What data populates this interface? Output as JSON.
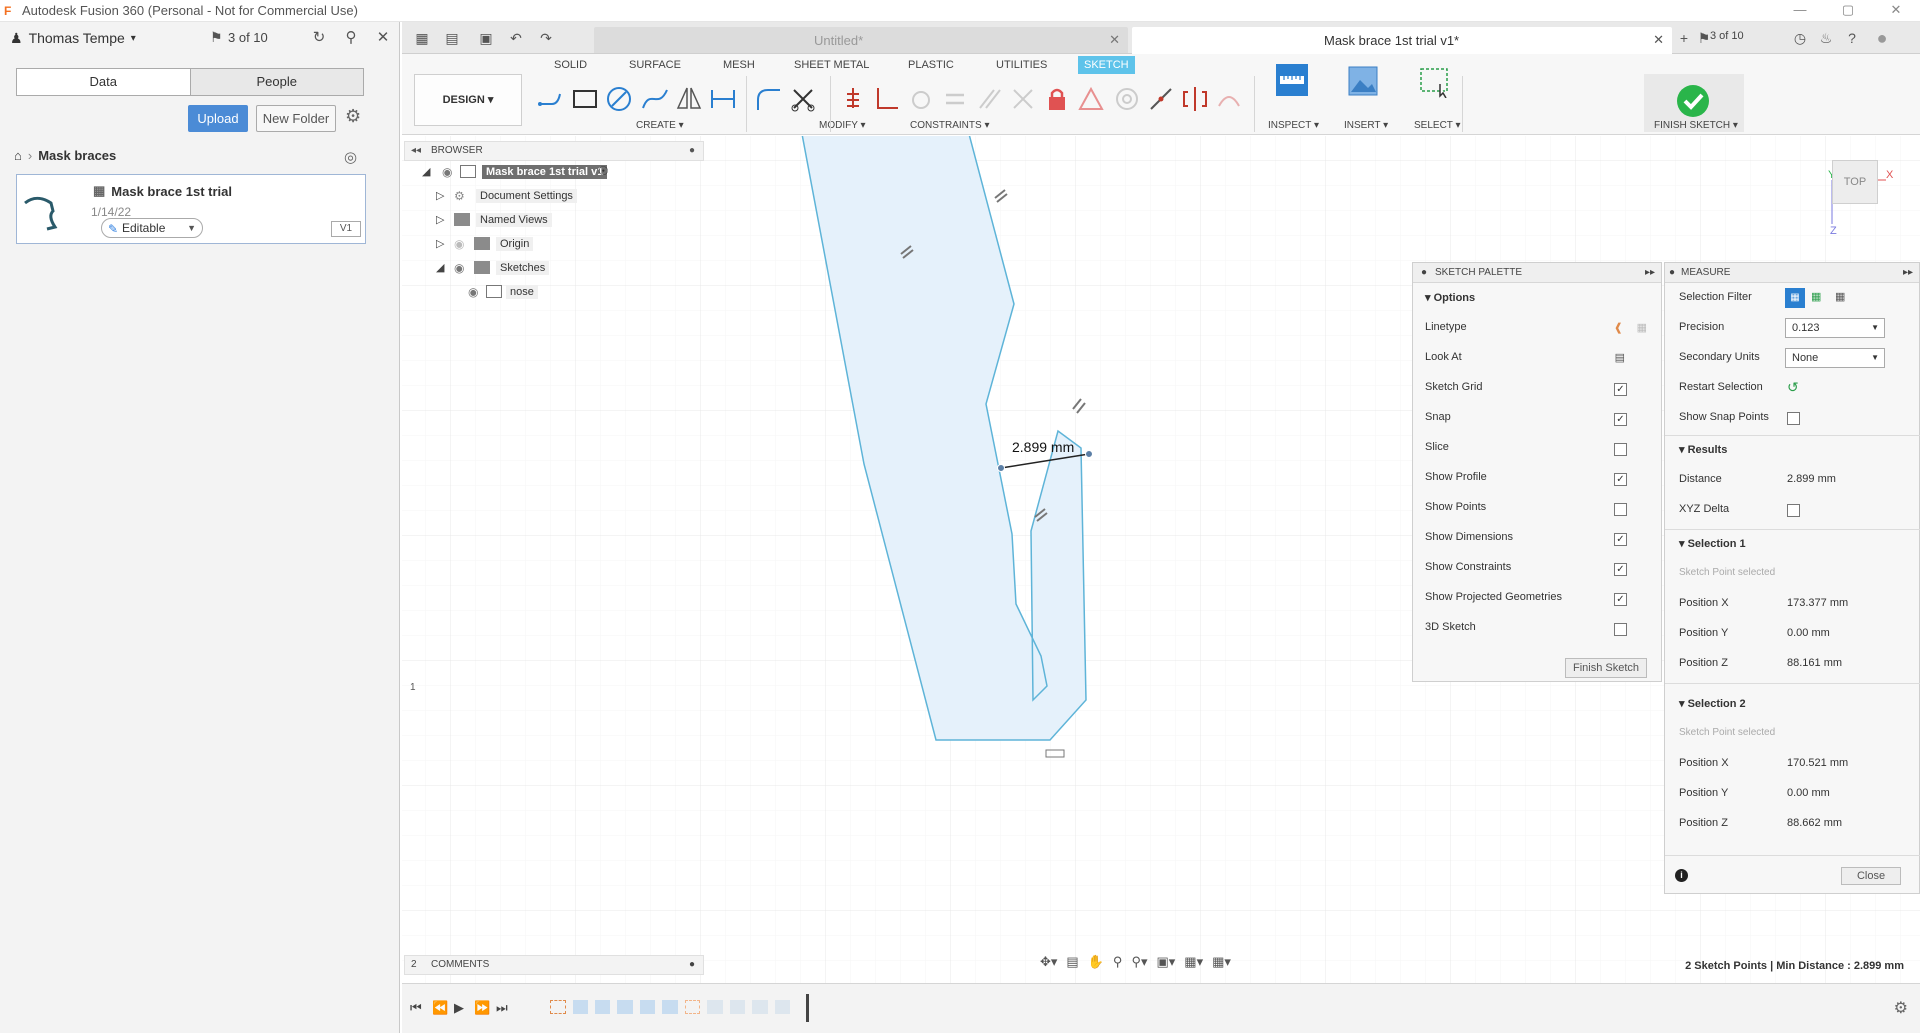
{
  "window": {
    "title": "Autodesk Fusion 360 (Personal - Not for Commercial Use)"
  },
  "left_panel": {
    "user": "Thomas Tempe",
    "count": "3 of 10",
    "tabs": [
      "Data",
      "People"
    ],
    "upload_label": "Upload",
    "new_folder_label": "New Folder",
    "breadcrumb_folder": "Mask braces",
    "file": {
      "name": "Mask brace 1st trial",
      "date": "1/14/22",
      "status": "Editable",
      "version": "V1"
    }
  },
  "doc_tabs": {
    "untitled": "Untitled*",
    "active": "Mask brace 1st trial v1*",
    "count": "3 of 10"
  },
  "toolbar": {
    "workspace_button": "DESIGN",
    "ws_tabs": [
      "SOLID",
      "SURFACE",
      "MESH",
      "SHEET METAL",
      "PLASTIC",
      "UTILITIES",
      "SKETCH"
    ],
    "active_tab": "SKETCH",
    "groups": [
      "CREATE",
      "MODIFY",
      "CONSTRAINTS",
      "INSPECT",
      "INSERT",
      "SELECT",
      "FINISH SKETCH"
    ]
  },
  "browser": {
    "title": "BROWSER",
    "items": [
      {
        "label": "Mask brace 1st trial v1"
      },
      {
        "label": "Document Settings"
      },
      {
        "label": "Named Views"
      },
      {
        "label": "Origin"
      },
      {
        "label": "Sketches"
      },
      {
        "label": "nose"
      }
    ]
  },
  "canvas": {
    "dimension_label": "2.899 mm",
    "view_cube": "TOP",
    "axis_x": "X",
    "axis_y": "Y",
    "axis_z": "Z",
    "marker_1": "1",
    "marker_2": "2"
  },
  "sketch_palette": {
    "title": "SKETCH PALETTE",
    "section": "Options",
    "rows": [
      {
        "label": "Linetype",
        "checked": null
      },
      {
        "label": "Look At",
        "checked": null
      },
      {
        "label": "Sketch Grid",
        "checked": true
      },
      {
        "label": "Snap",
        "checked": true
      },
      {
        "label": "Slice",
        "checked": false
      },
      {
        "label": "Show Profile",
        "checked": true
      },
      {
        "label": "Show Points",
        "checked": false
      },
      {
        "label": "Show Dimensions",
        "checked": true
      },
      {
        "label": "Show Constraints",
        "checked": true
      },
      {
        "label": "Show Projected Geometries",
        "checked": true
      },
      {
        "label": "3D Sketch",
        "checked": false
      }
    ],
    "finish_label": "Finish Sketch"
  },
  "measure": {
    "title": "MEASURE",
    "selection_filter": "Selection Filter",
    "precision_label": "Precision",
    "precision_value": "0.123",
    "secondary_units_label": "Secondary Units",
    "secondary_units_value": "None",
    "restart_selection": "Restart Selection",
    "show_snap_points": "Show Snap Points",
    "results_title": "Results",
    "distance_label": "Distance",
    "distance_value": "2.899 mm",
    "xyz_delta": "XYZ Delta",
    "selection1": {
      "title": "Selection 1",
      "hint": "Sketch Point selected",
      "x": "173.377 mm",
      "y": "0.00 mm",
      "z": "88.161 mm"
    },
    "selection2": {
      "title": "Selection 2",
      "hint": "Sketch Point selected",
      "x": "170.521 mm",
      "y": "0.00 mm",
      "z": "88.662 mm"
    },
    "pos_x_label": "Position X",
    "pos_y_label": "Position Y",
    "pos_z_label": "Position Z",
    "close_label": "Close"
  },
  "bottom": {
    "comments": "COMMENTS",
    "status": "2 Sketch Points | Min Distance : 2.899 mm"
  }
}
